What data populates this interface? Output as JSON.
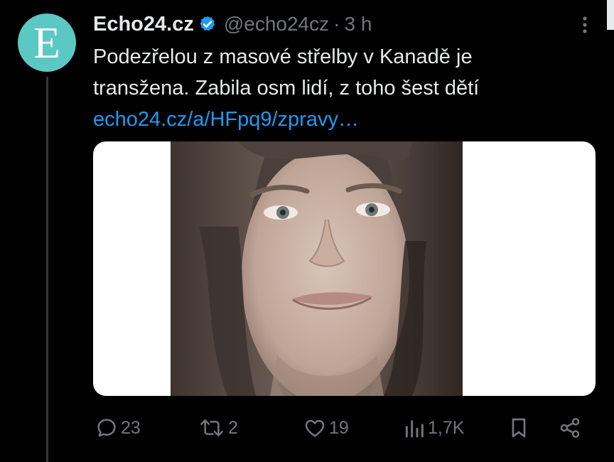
{
  "account": {
    "avatar_letter": "E",
    "display_name": "Echo24.cz",
    "handle": "@echo24cz",
    "separator": "·",
    "time": "3 h"
  },
  "tweet": {
    "line1": "Podezřelou z masové střelby v Kanadě je",
    "line2": "transžena. Zabila osm lidí, z toho šest dětí",
    "link": "echo24.cz/a/HFpq9/zpravy…"
  },
  "actions": {
    "replies": "23",
    "reposts": "2",
    "likes": "19",
    "views": "1,7K"
  },
  "colors": {
    "background": "#000000",
    "text": "#e7e9ea",
    "secondary": "#71767b",
    "link": "#1d9bf0",
    "avatar": "#5cc8c3",
    "verified": "#1d9bf0"
  },
  "icons": [
    "more-icon",
    "verified-badge-icon",
    "reply-icon",
    "repost-icon",
    "like-icon",
    "views-icon",
    "bookmark-icon",
    "share-icon"
  ]
}
